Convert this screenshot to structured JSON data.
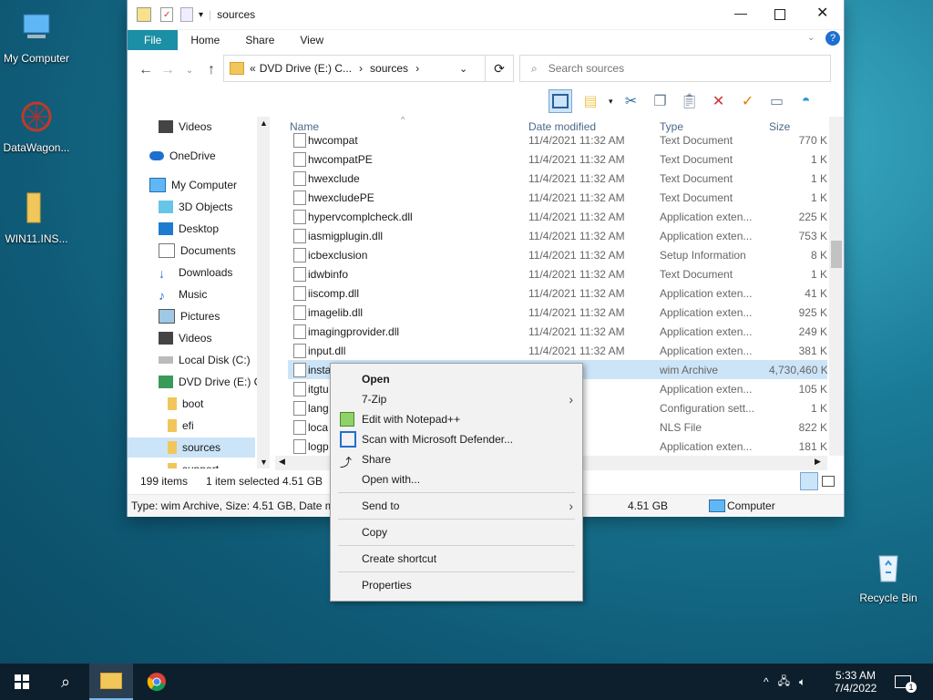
{
  "desktop": {
    "icons": [
      {
        "label": "My Computer"
      },
      {
        "label": "DataWagon..."
      },
      {
        "label": "WIN11.INS..."
      },
      {
        "label": "Recycle Bin"
      }
    ]
  },
  "window": {
    "title": "sources",
    "ribbon_tabs": [
      "File",
      "Home",
      "Share",
      "View"
    ],
    "address": {
      "prefix": "«",
      "crumbs": [
        "DVD Drive (E:) C...",
        "sources"
      ]
    },
    "search_placeholder": "Search sources",
    "nav_items": [
      {
        "label": "Videos"
      },
      {
        "label": "OneDrive"
      },
      {
        "label": "My Computer"
      },
      {
        "label": "3D Objects"
      },
      {
        "label": "Desktop"
      },
      {
        "label": "Documents"
      },
      {
        "label": "Downloads"
      },
      {
        "label": "Music"
      },
      {
        "label": "Pictures"
      },
      {
        "label": "Videos"
      },
      {
        "label": "Local Disk (C:)"
      },
      {
        "label": "DVD Drive (E:) C"
      },
      {
        "label": "boot"
      },
      {
        "label": "efi"
      },
      {
        "label": "sources"
      },
      {
        "label": "support"
      }
    ],
    "columns": [
      "Name",
      "Date modified",
      "Type",
      "Size"
    ],
    "files": [
      {
        "name": "hwcompat",
        "date": "11/4/2021 11:32 AM",
        "type": "Text Document",
        "size": "770 KB"
      },
      {
        "name": "hwcompatPE",
        "date": "11/4/2021 11:32 AM",
        "type": "Text Document",
        "size": "1 KB"
      },
      {
        "name": "hwexclude",
        "date": "11/4/2021 11:32 AM",
        "type": "Text Document",
        "size": "1 KB"
      },
      {
        "name": "hwexcludePE",
        "date": "11/4/2021 11:32 AM",
        "type": "Text Document",
        "size": "1 KB"
      },
      {
        "name": "hypervcomplcheck.dll",
        "date": "11/4/2021 11:32 AM",
        "type": "Application exten...",
        "size": "225 KB"
      },
      {
        "name": "iasmigplugin.dll",
        "date": "11/4/2021 11:32 AM",
        "type": "Application exten...",
        "size": "753 KB"
      },
      {
        "name": "icbexclusion",
        "date": "11/4/2021 11:32 AM",
        "type": "Setup Information",
        "size": "8 KB"
      },
      {
        "name": "idwbinfo",
        "date": "11/4/2021 11:32 AM",
        "type": "Text Document",
        "size": "1 KB"
      },
      {
        "name": "iiscomp.dll",
        "date": "11/4/2021 11:32 AM",
        "type": "Application exten...",
        "size": "41 KB"
      },
      {
        "name": "imagelib.dll",
        "date": "11/4/2021 11:32 AM",
        "type": "Application exten...",
        "size": "925 KB"
      },
      {
        "name": "imagingprovider.dll",
        "date": "11/4/2021 11:32 AM",
        "type": "Application exten...",
        "size": "249 KB"
      },
      {
        "name": "input.dll",
        "date": "11/4/2021 11:32 AM",
        "type": "Application exten...",
        "size": "381 KB"
      },
      {
        "name": "insta",
        "date": "1:33 AM",
        "type": "wim Archive",
        "size": "4,730,460 KB"
      },
      {
        "name": "itgtu",
        "date": "1:33 AM",
        "type": "Application exten...",
        "size": "105 KB"
      },
      {
        "name": "lang",
        "date": "1:33 AM",
        "type": "Configuration sett...",
        "size": "1 KB"
      },
      {
        "name": "loca",
        "date": "1:33 AM",
        "type": "NLS File",
        "size": "822 KB"
      },
      {
        "name": "logp",
        "date": "1:33 AM",
        "type": "Application exten...",
        "size": "181 KB"
      }
    ],
    "status": {
      "items": "199 items",
      "selected": "1 item selected",
      "selected_size": "4.51 GB"
    },
    "details": {
      "text": "Type: wim Archive, Size: 4.51 GB, Date mo",
      "size": "4.51 GB",
      "location": "Computer"
    }
  },
  "context_menu": {
    "items": [
      {
        "label": "Open"
      },
      {
        "label": "7-Zip"
      },
      {
        "label": "Edit with Notepad++"
      },
      {
        "label": "Scan with Microsoft Defender..."
      },
      {
        "label": "Share"
      },
      {
        "label": "Open with..."
      },
      {
        "label": "Send to"
      },
      {
        "label": "Copy"
      },
      {
        "label": "Create shortcut"
      },
      {
        "label": "Properties"
      }
    ]
  },
  "taskbar": {
    "time": "5:33 AM",
    "date": "7/4/2022",
    "notification_count": "1"
  },
  "colors": {
    "accent": "#1b8fa5",
    "selection": "#cce4f7",
    "delete": "#d32f2f",
    "check": "#e07b00"
  }
}
